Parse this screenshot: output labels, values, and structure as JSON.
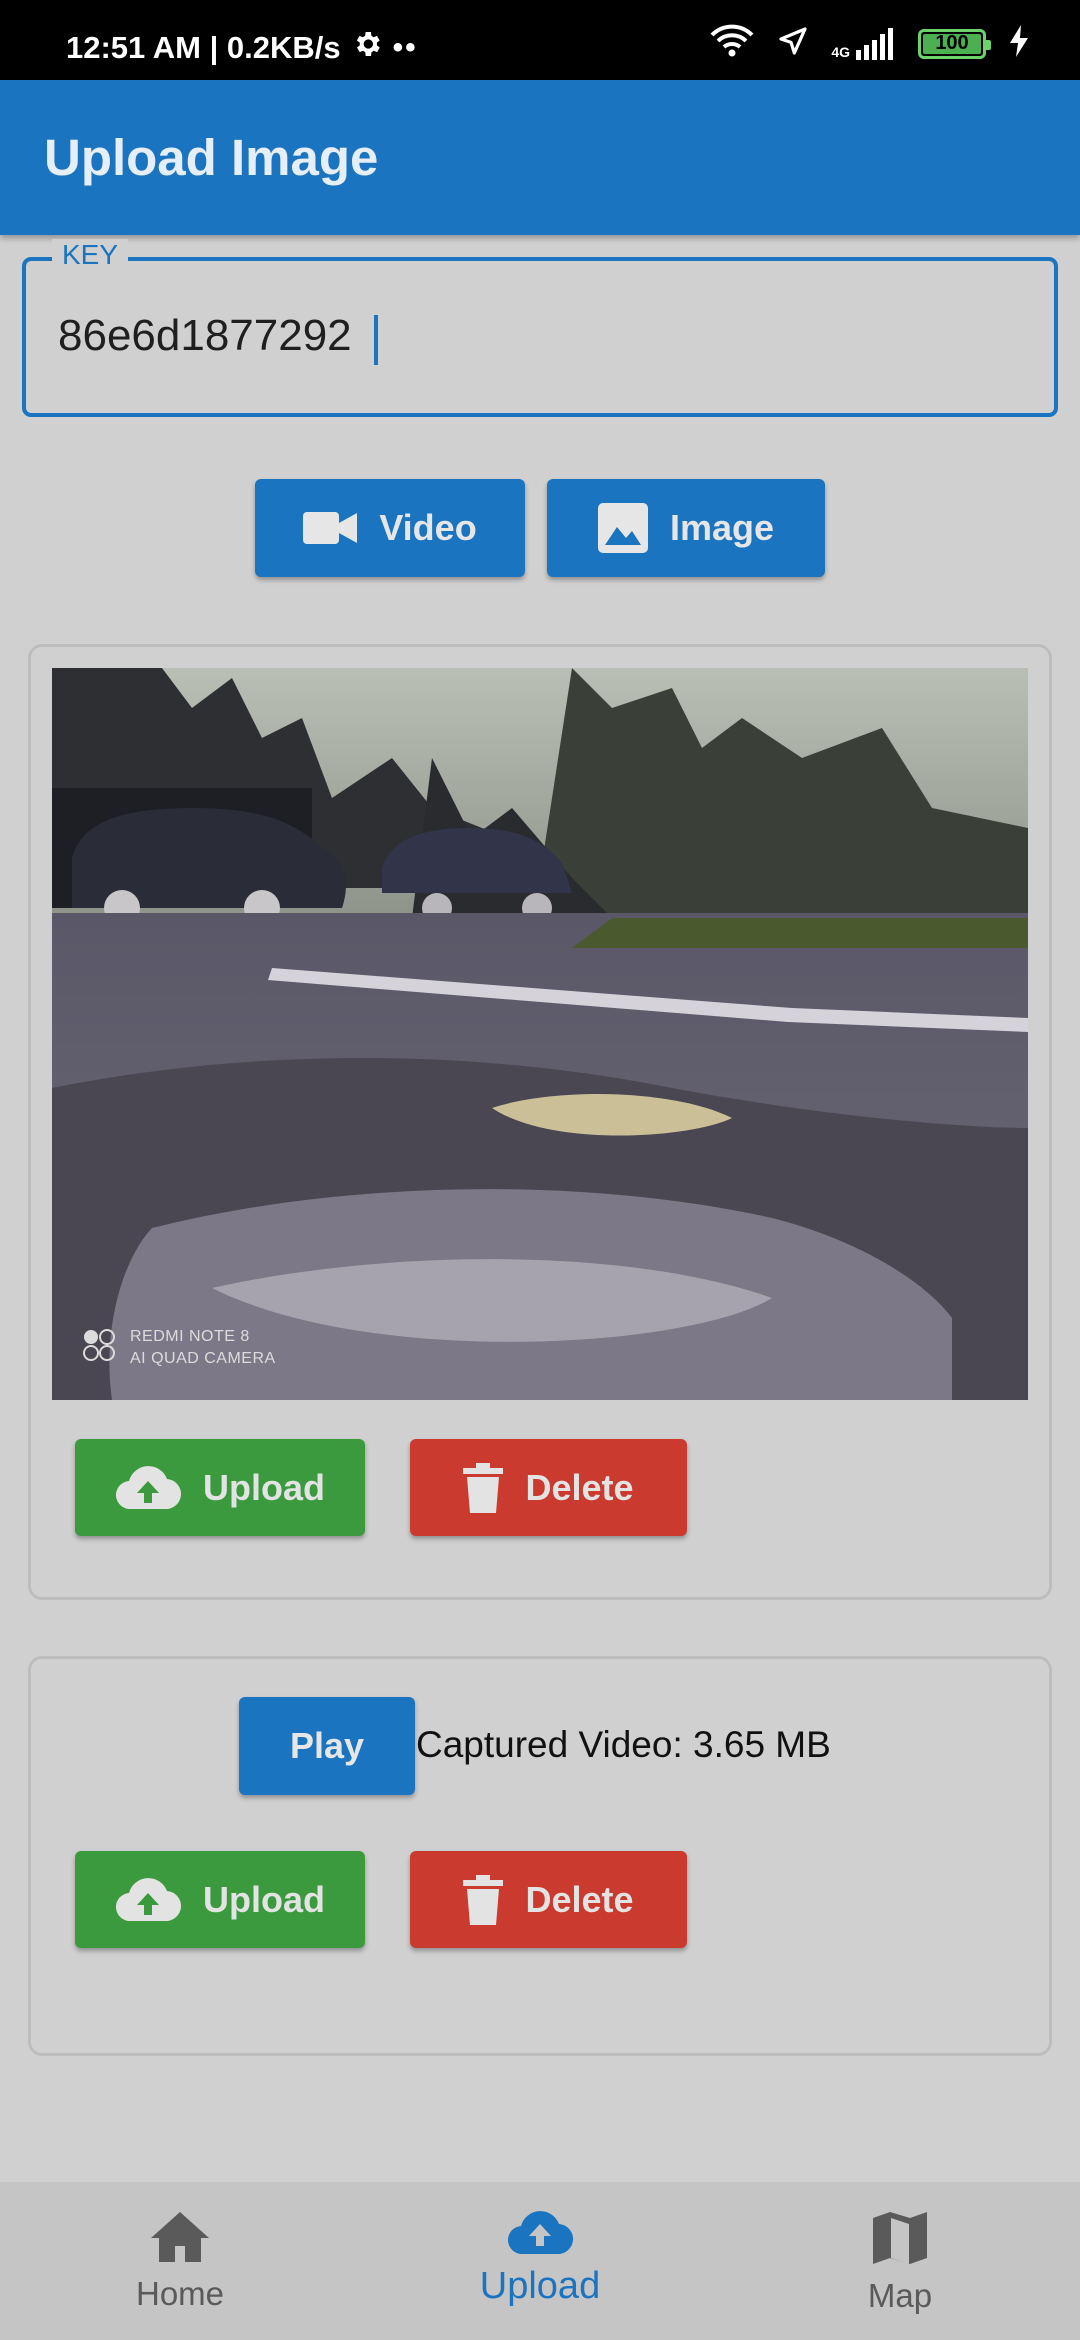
{
  "status_bar": {
    "time_text": "12:51 AM | 0.2KB/s",
    "battery": "100",
    "network": "4G",
    "icons": [
      "gear-icon",
      "wifi-icon",
      "location-arrow-icon",
      "signal-icon",
      "battery-icon",
      "charging-icon"
    ]
  },
  "app_bar": {
    "title": "Upload Image"
  },
  "key_field": {
    "label": "KEY",
    "value": "86e6d1877292"
  },
  "capture_buttons": {
    "video_label": "Video",
    "image_label": "Image"
  },
  "image_card": {
    "watermark_line1": "REDMI NOTE 8",
    "watermark_line2": "AI QUAD CAMERA",
    "upload_label": "Upload",
    "delete_label": "Delete"
  },
  "video_card": {
    "play_label": "Play",
    "info_text": "Captured Video: 3.65 MB",
    "upload_label": "Upload",
    "delete_label": "Delete"
  },
  "bottom_nav": {
    "items": [
      {
        "label": "Home",
        "icon": "home-icon",
        "active": false
      },
      {
        "label": "Upload",
        "icon": "cloud-upload-icon",
        "active": true
      },
      {
        "label": "Map",
        "icon": "map-icon",
        "active": false
      }
    ]
  },
  "colors": {
    "primary": "#1a74c0",
    "upload_green": "#3a9a3d",
    "delete_red": "#cb3a2f",
    "background": "#d0d0d0"
  }
}
